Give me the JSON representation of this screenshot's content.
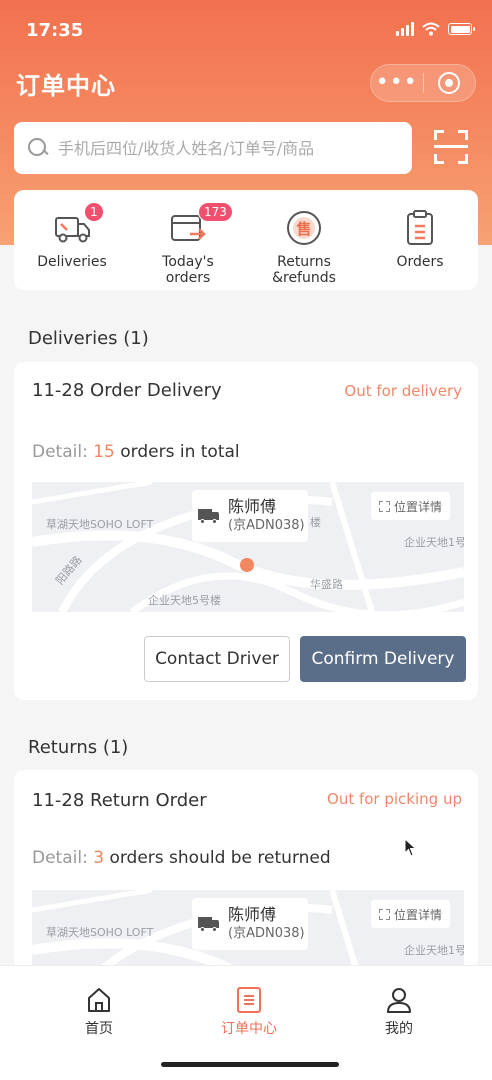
{
  "status_bar": {
    "time": "17:35"
  },
  "header": {
    "title": "订单中心",
    "more_label": "•••"
  },
  "search": {
    "placeholder": "手机后四位/收货人姓名/订单号/商品"
  },
  "quick_actions": [
    {
      "label": "Deliveries",
      "badge": "1",
      "icon": "delivery-truck-icon"
    },
    {
      "label": "Today's orders",
      "badge": "173",
      "icon": "cart-arrow-icon"
    },
    {
      "label": "Returns &refunds",
      "badge": "",
      "icon": "refund-icon",
      "icon_char": "售"
    },
    {
      "label": "Orders",
      "badge": "",
      "icon": "clipboard-icon"
    }
  ],
  "deliveries": {
    "section_title": "Deliveries (1)",
    "card_title": "11-28 Order Delivery",
    "status": "Out for delivery",
    "detail_label": "Detail:",
    "count": "15",
    "detail_text": "orders in total",
    "map": {
      "driver_name": "陈师傅",
      "plate": "(京ADN038)",
      "location_btn": "位置详情",
      "labels": [
        "草湖天地SOHO LOFT",
        "企业天地1号",
        "华盛路",
        "企业天地5号楼",
        "阳路路",
        "楼"
      ]
    },
    "buttons": {
      "contact": "Contact Driver",
      "confirm": "Confirm Delivery"
    }
  },
  "returns": {
    "section_title": "Returns (1)",
    "card_title": "11-28 Return Order",
    "status": "Out for picking up",
    "detail_label": "Detail:",
    "count": "3",
    "detail_text": "orders should be returned",
    "map": {
      "driver_name": "陈师傅",
      "plate": "(京ADN038)",
      "location_btn": "位置详情",
      "labels": [
        "草湖天地SOHO LOFT",
        "企业天地1号"
      ]
    }
  },
  "tabbar": [
    {
      "label": "首页",
      "icon": "home-icon",
      "active": false
    },
    {
      "label": "订单中心",
      "icon": "order-list-icon",
      "active": true
    },
    {
      "label": "我的",
      "icon": "profile-icon",
      "active": false
    }
  ],
  "colors": {
    "accent": "#f2714f",
    "primary_button": "#5a6e8a",
    "status_text": "#f0876a",
    "badge": "#f0506e"
  }
}
